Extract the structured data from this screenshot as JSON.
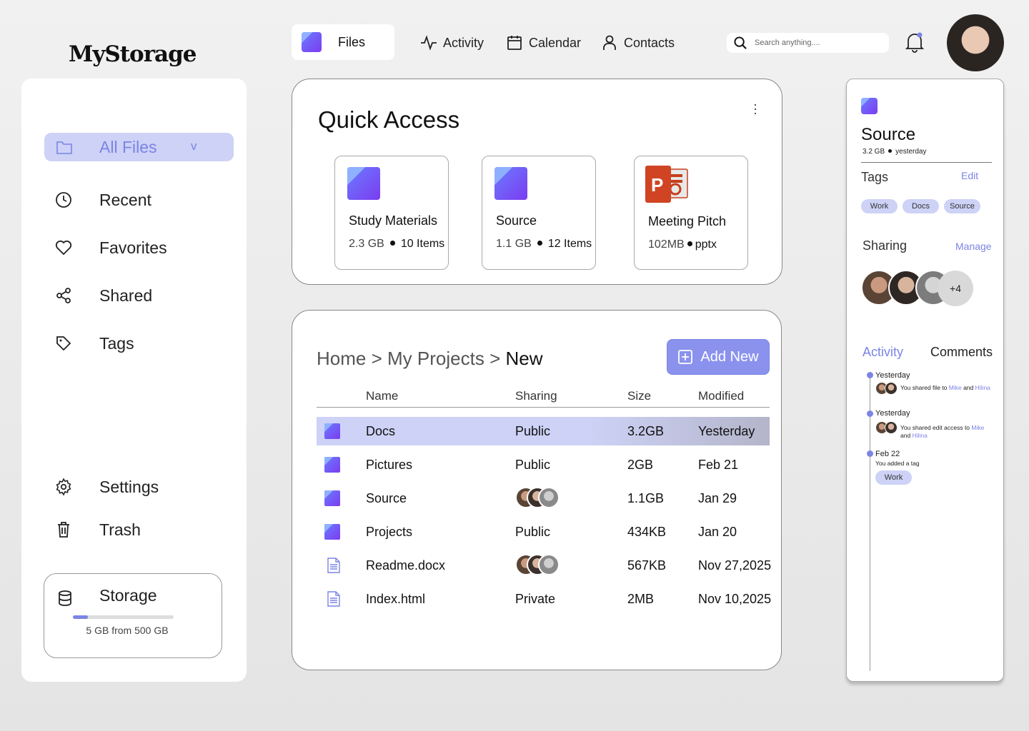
{
  "app": {
    "logo": "MyStorage"
  },
  "sidebar": {
    "items": [
      {
        "label": "All Files",
        "icon": "folder-icon",
        "active": true,
        "chevron": "v"
      },
      {
        "label": "Recent",
        "icon": "clock-icon"
      },
      {
        "label": "Favorites",
        "icon": "heart-icon"
      },
      {
        "label": "Shared",
        "icon": "share-icon"
      },
      {
        "label": "Tags",
        "icon": "tag-icon"
      },
      {
        "label": "Settings",
        "icon": "gear-icon"
      },
      {
        "label": "Trash",
        "icon": "trash-icon"
      }
    ],
    "storage": {
      "title": "Storage",
      "text": "5 GB from 500 GB",
      "used_fraction": 0.15
    }
  },
  "topnav": {
    "tabs": [
      {
        "label": "Files",
        "icon": "folder-icon",
        "active": true
      },
      {
        "label": "Activity",
        "icon": "activity-icon"
      },
      {
        "label": "Calendar",
        "icon": "calendar-icon"
      },
      {
        "label": "Contacts",
        "icon": "user-icon"
      }
    ],
    "search_placeholder": "Search anything....",
    "notification_icon": "bell-icon"
  },
  "quick_access": {
    "title": "Quick Access",
    "items": [
      {
        "name": "Study Materials",
        "size": "2.3 GB",
        "detail": "10 Items",
        "icon": "folder-icon"
      },
      {
        "name": "Source",
        "size": "1.1 GB",
        "detail": "12 Items",
        "icon": "folder-icon"
      },
      {
        "name": "Meeting Pitch",
        "size": "102MB",
        "detail": "pptx",
        "icon": "powerpoint-icon"
      }
    ]
  },
  "files": {
    "breadcrumb": [
      "Home",
      ">",
      "My Projects",
      ">",
      "New"
    ],
    "add_new_label": "Add New",
    "columns": [
      "Name",
      "Sharing",
      "Size",
      "Modified"
    ],
    "rows": [
      {
        "name": "Docs",
        "sharing": "Public",
        "size": "3.2GB",
        "modified": "Yesterday",
        "type": "folder",
        "selected": true
      },
      {
        "name": "Pictures",
        "sharing": "Public",
        "size": "2GB",
        "modified": "Feb 21",
        "type": "folder"
      },
      {
        "name": "Source",
        "sharing": "",
        "size": "1.1GB",
        "modified": "Jan 29",
        "type": "folder",
        "shared_avatars": 3
      },
      {
        "name": "Projects",
        "sharing": "Public",
        "size": "434KB",
        "modified": "Jan 20",
        "type": "folder"
      },
      {
        "name": "Readme.docx",
        "sharing": "",
        "size": "567KB",
        "modified": "Nov 27,2025",
        "type": "document",
        "shared_avatars": 3
      },
      {
        "name": "Index.html",
        "sharing": "Private",
        "size": "2MB",
        "modified": "Nov 10,2025",
        "type": "document"
      }
    ]
  },
  "details": {
    "title": "Source",
    "size": "3.2 GB",
    "modified": "yesterday",
    "tags_label": "Tags",
    "tags_action": "Edit",
    "tags": [
      "Work",
      "Docs",
      "Source"
    ],
    "sharing_label": "Sharing",
    "sharing_action": "Manage",
    "sharing_more": "+4",
    "tabs": [
      "Activity",
      "Comments"
    ],
    "activity": [
      {
        "date": "Yesterday",
        "text": "You shared file to",
        "people": [
          "Mike",
          "Hilina"
        ],
        "joiner": "and"
      },
      {
        "date": "Yesterday",
        "text": "You shared edit access to",
        "people": [
          "Mike",
          "Hilina"
        ],
        "joiner": "and"
      },
      {
        "date": "Feb 22",
        "text": "You added a tag",
        "tag": "Work"
      }
    ]
  },
  "colors": {
    "accent": "#7b84e6",
    "accent_light": "#cdd2f6"
  }
}
